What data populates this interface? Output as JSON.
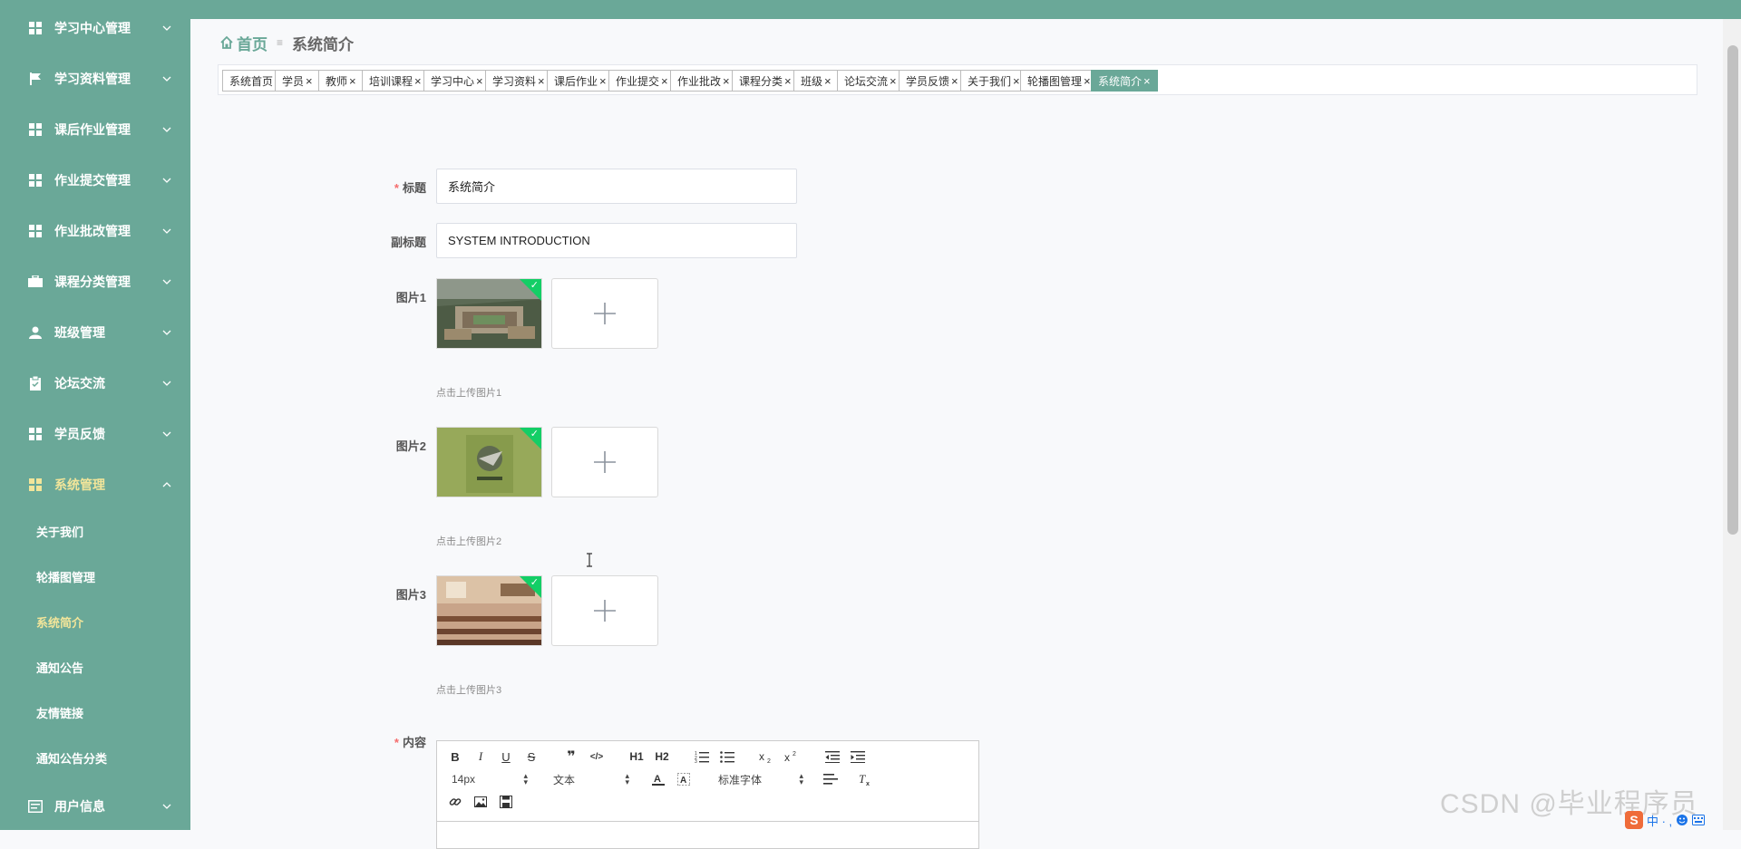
{
  "sidebar": {
    "menu": [
      {
        "label": "学习中心管理",
        "icon": "grid-icon"
      },
      {
        "label": "学习资料管理",
        "icon": "flag-icon"
      },
      {
        "label": "课后作业管理",
        "icon": "grid-icon"
      },
      {
        "label": "作业提交管理",
        "icon": "grid-icon"
      },
      {
        "label": "作业批改管理",
        "icon": "grid-icon"
      },
      {
        "label": "课程分类管理",
        "icon": "briefcase-icon"
      },
      {
        "label": "班级管理",
        "icon": "user-icon"
      },
      {
        "label": "论坛交流",
        "icon": "clipboard-icon"
      },
      {
        "label": "学员反馈",
        "icon": "grid-icon"
      },
      {
        "label": "系统管理",
        "icon": "grid-icon"
      }
    ],
    "submenu": [
      {
        "label": "关于我们"
      },
      {
        "label": "轮播图管理"
      },
      {
        "label": "系统简介"
      },
      {
        "label": "通知公告"
      },
      {
        "label": "友情链接"
      },
      {
        "label": "通知公告分类"
      }
    ],
    "user_menu": {
      "label": "用户信息",
      "icon": "id-card-icon"
    },
    "active_sub": "系统简介",
    "colors": {
      "background": "#6aa898",
      "active_text": "#f2e59a"
    }
  },
  "breadcrumb": {
    "home": "首页",
    "separator": "≡",
    "current": "系统简介"
  },
  "tags": [
    {
      "label": "系统首页",
      "closable": false
    },
    {
      "label": "学员",
      "closable": true
    },
    {
      "label": "教师",
      "closable": true
    },
    {
      "label": "培训课程",
      "closable": true
    },
    {
      "label": "学习中心",
      "closable": true
    },
    {
      "label": "学习资料",
      "closable": true
    },
    {
      "label": "课后作业",
      "closable": true
    },
    {
      "label": "作业提交",
      "closable": true
    },
    {
      "label": "作业批改",
      "closable": true
    },
    {
      "label": "课程分类",
      "closable": true
    },
    {
      "label": "班级",
      "closable": true
    },
    {
      "label": "论坛交流",
      "closable": true
    },
    {
      "label": "学员反馈",
      "closable": true
    },
    {
      "label": "关于我们",
      "closable": true
    },
    {
      "label": "轮播图管理",
      "closable": true
    },
    {
      "label": "系统简介",
      "closable": true,
      "active": true
    }
  ],
  "form": {
    "title": {
      "label": "标题",
      "required": true,
      "value": "系统简介"
    },
    "subtitle": {
      "label": "副标题",
      "value": "SYSTEM INTRODUCTION"
    },
    "images": [
      {
        "label": "图片1",
        "hint": "点击上传图片1"
      },
      {
        "label": "图片2",
        "hint": "点击上传图片2"
      },
      {
        "label": "图片3",
        "hint": "点击上传图片3"
      }
    ],
    "content": {
      "label": "内容",
      "required": true
    }
  },
  "editor": {
    "font_size": "14px",
    "paragraph": "文本",
    "font_family": "标准字体",
    "buttons": {
      "h1": "H1",
      "h2": "H2"
    }
  },
  "watermark": "CSDN @毕业程序员",
  "ime": {
    "badge": "S",
    "text": "中 · ,"
  },
  "colors": {
    "accent": "#6aa898",
    "required": "#f56c6c",
    "upload_success": "#13ce66"
  }
}
